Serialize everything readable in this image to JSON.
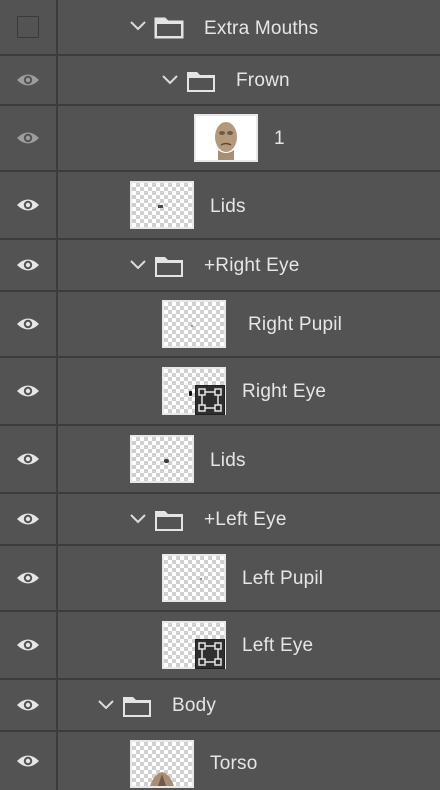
{
  "layers": [
    {
      "label": "Extra Mouths",
      "kind": "group",
      "visible": false
    },
    {
      "label": "Frown",
      "kind": "group",
      "visible": "dim"
    },
    {
      "label": "1",
      "kind": "image",
      "visible": "dim"
    },
    {
      "label": "Lids",
      "kind": "layer",
      "visible": true
    },
    {
      "label": "+Right Eye",
      "kind": "group",
      "visible": true
    },
    {
      "label": "Right Pupil",
      "kind": "layer",
      "visible": true
    },
    {
      "label": "Right Eye",
      "kind": "smart-object",
      "visible": true
    },
    {
      "label": "Lids",
      "kind": "layer",
      "visible": true
    },
    {
      "label": "+Left Eye",
      "kind": "group",
      "visible": true
    },
    {
      "label": "Left Pupil",
      "kind": "layer",
      "visible": true
    },
    {
      "label": "Left Eye",
      "kind": "smart-object",
      "visible": true
    },
    {
      "label": "Body",
      "kind": "group",
      "visible": true
    },
    {
      "label": "Torso",
      "kind": "layer",
      "visible": true
    }
  ],
  "icons": {
    "visibility": "eye-icon",
    "group": "folder-icon",
    "expand": "chevron-down-icon",
    "smart_object": "transform-icon"
  }
}
